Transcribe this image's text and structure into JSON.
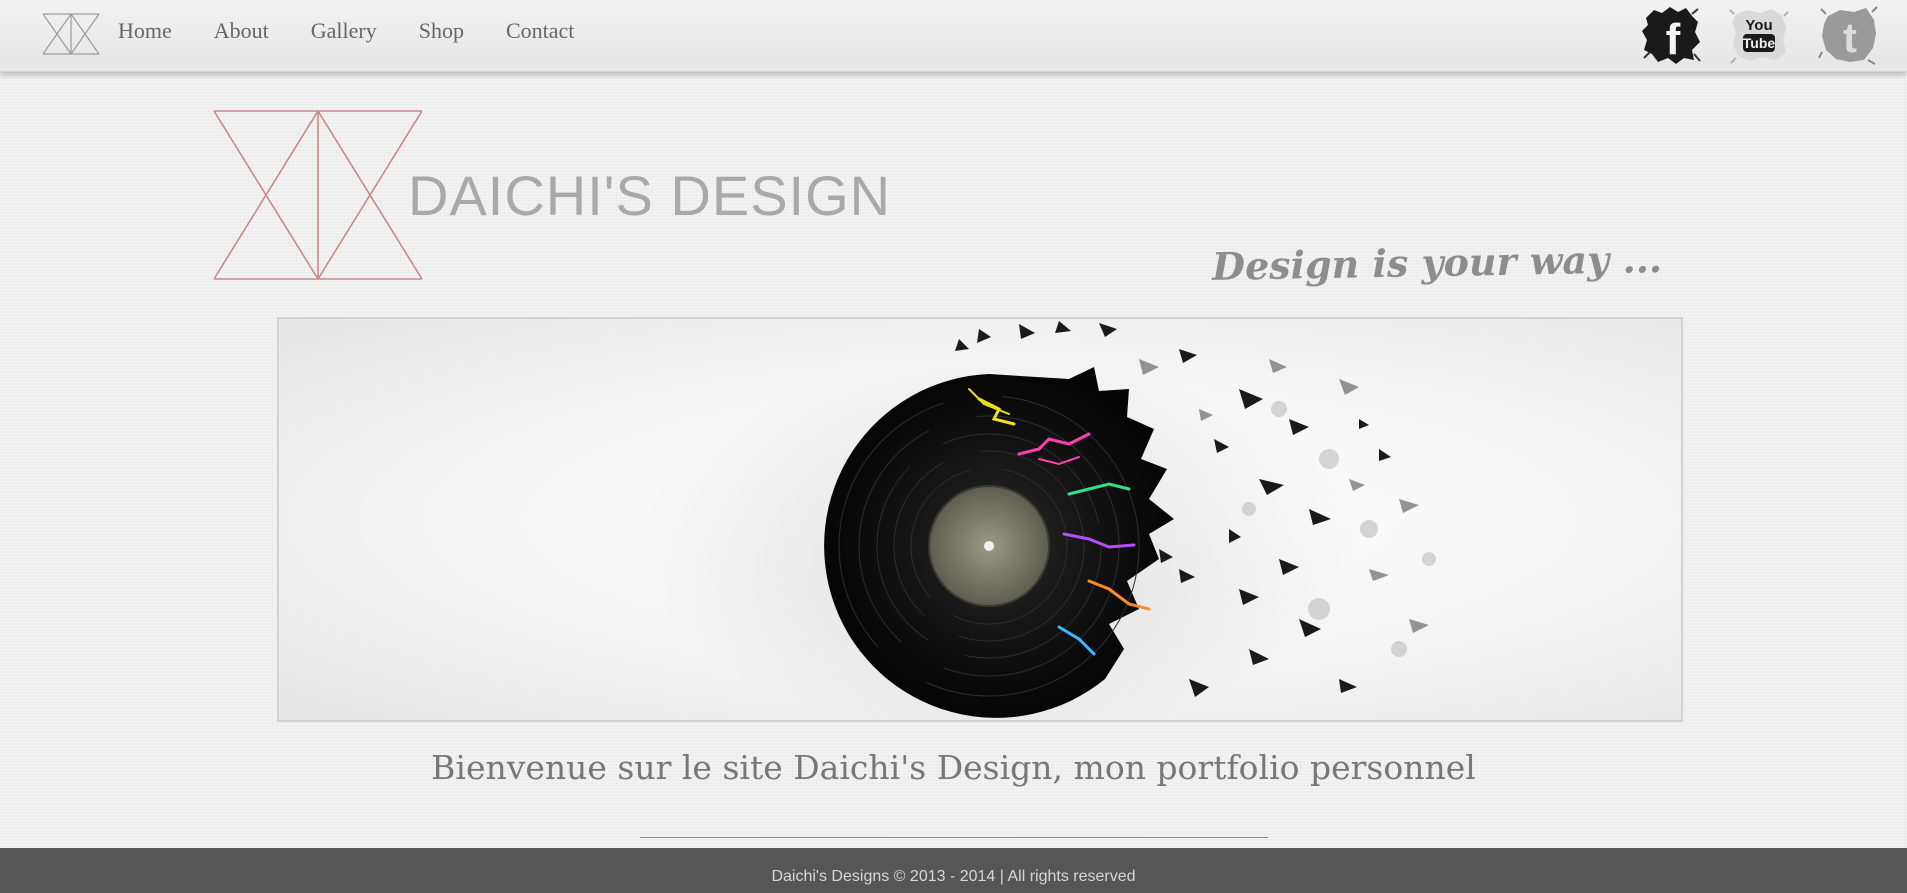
{
  "nav": {
    "logo": "site-monogram-logo",
    "links": [
      "Home",
      "About",
      "Gallery",
      "Shop",
      "Contact"
    ],
    "social": [
      {
        "name": "facebook-icon",
        "label": "f"
      },
      {
        "name": "youtube-icon",
        "label_top": "You",
        "label_bottom": "Tube"
      },
      {
        "name": "twitter-icon",
        "label": "t"
      }
    ]
  },
  "brand": {
    "title": "DAICHI'S DESIGN",
    "tagline": "Design is your way ...",
    "logo_color": "#c98888"
  },
  "hero": {
    "image": "shattered-vinyl-record-illustration",
    "colors": [
      "#e8e020",
      "#ff3fb0",
      "#2fe08a",
      "#b64cff",
      "#ff8a2a",
      "#3fb6ff"
    ]
  },
  "main": {
    "welcome": "Bienvenue sur le site Daichi's Design, mon portfolio personnel"
  },
  "footer": {
    "text": "Daichi's Designs © 2013 - 2014 | All rights reserved",
    "background": "#565656"
  }
}
